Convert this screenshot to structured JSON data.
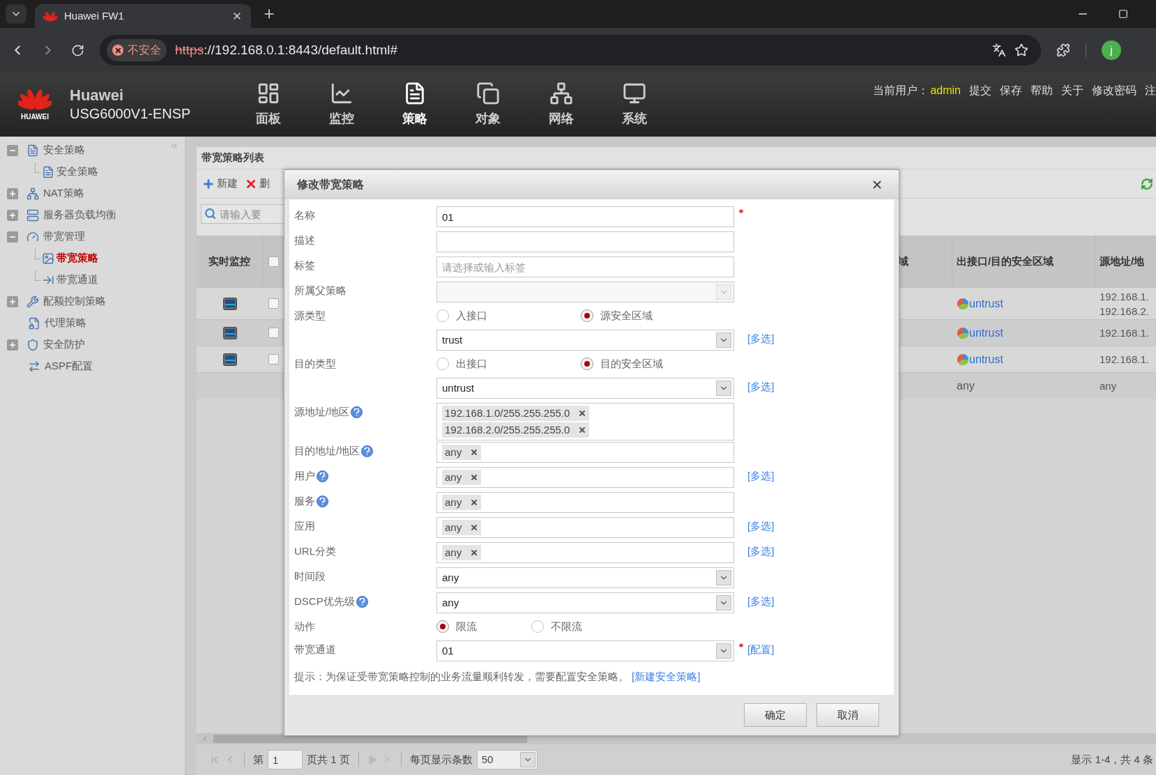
{
  "browser": {
    "tab_title": "Huawei FW1",
    "security_label": "不安全",
    "url_scheme": "https",
    "url_rest": "://192.168.0.1:8443/default.html#",
    "profile_initial": "j"
  },
  "header": {
    "logo_text": "HUAWEI",
    "brand": "Huawei",
    "model": "USG6000V1-ENSP",
    "nav": [
      {
        "label": "面板",
        "selected": false
      },
      {
        "label": "监控",
        "selected": false
      },
      {
        "label": "策略",
        "selected": true
      },
      {
        "label": "对象",
        "selected": false
      },
      {
        "label": "网络",
        "selected": false
      },
      {
        "label": "系统",
        "selected": false
      }
    ],
    "user_label": "当前用户：",
    "user": "admin",
    "actions": [
      "提交",
      "保存",
      "帮助",
      "关于",
      "修改密码",
      "注"
    ]
  },
  "sidebar": {
    "items": [
      {
        "label": "安全策略",
        "expanded": true,
        "selected": false,
        "children": [
          {
            "label": "安全策略",
            "selected": false
          }
        ]
      },
      {
        "label": "NAT策略",
        "expanded": false,
        "selected": false
      },
      {
        "label": "服务器负载均衡",
        "expanded": false,
        "selected": false
      },
      {
        "label": "带宽管理",
        "expanded": true,
        "selected": false,
        "children": [
          {
            "label": "带宽策略",
            "selected": true
          },
          {
            "label": "带宽通道",
            "selected": false
          }
        ]
      },
      {
        "label": "配额控制策略",
        "expanded": false,
        "selected": false
      },
      {
        "label": "代理策略",
        "selected": false
      },
      {
        "label": "安全防护",
        "expanded": false,
        "selected": false
      },
      {
        "label": "ASPF配置",
        "selected": false
      }
    ]
  },
  "list": {
    "title": "带宽策略列表",
    "toolbar": [
      {
        "kind": "add",
        "label": "新建"
      },
      {
        "kind": "delete",
        "label": "删"
      }
    ],
    "search_placeholder": "请输入要",
    "table": {
      "columns": [
        "实时监控",
        "域",
        "出接口/目的安全区域",
        "源地址/地"
      ],
      "select_all_checked": false,
      "rows": [
        {
          "kind": "policy",
          "checked": false,
          "out_zone": "untrust",
          "source": [
            "192.168.1.",
            "192.168.2."
          ]
        },
        {
          "kind": "policy",
          "checked": false,
          "out_zone": "untrust",
          "source": [
            "192.168.1."
          ]
        },
        {
          "kind": "policy",
          "checked": false,
          "out_zone": "untrust",
          "source": [
            "192.168.1."
          ]
        },
        {
          "kind": "default",
          "out_zone": "any",
          "source": [
            "any"
          ]
        }
      ]
    }
  },
  "pager": {
    "page_prefix": "第",
    "page": "1",
    "page_total": "页共 1 页",
    "page_size_label": "每页显示条数",
    "page_size": "50",
    "summary": "显示 1-4，共 4 条"
  },
  "dialog": {
    "title": "修改带宽策略",
    "fields": [
      {
        "kind": "text",
        "label": "名称",
        "value": "01",
        "required": true,
        "help": false
      },
      {
        "kind": "text",
        "label": "描述",
        "required": false,
        "help": false
      },
      {
        "kind": "text",
        "label": "标签",
        "placeholder": "请选择或输入标签",
        "required": false,
        "help": false
      },
      {
        "kind": "select",
        "label": "所属父策略",
        "disabled": true,
        "required": false,
        "help": false
      },
      {
        "kind": "radio",
        "label": "源类型",
        "required": false,
        "help": false,
        "options": [
          {
            "label": "入接口",
            "selected": false
          },
          {
            "label": "源安全区域",
            "selected": true
          }
        ]
      },
      {
        "kind": "select",
        "value": "trust",
        "disabled": false,
        "required": false,
        "help": false,
        "link": "[多选]"
      },
      {
        "kind": "radio",
        "label": "目的类型",
        "required": false,
        "help": false,
        "options": [
          {
            "label": "出接口",
            "selected": false
          },
          {
            "label": "目的安全区域",
            "selected": true
          }
        ]
      },
      {
        "kind": "select",
        "value": "untrust",
        "disabled": false,
        "required": false,
        "help": false,
        "link": "[多选]"
      },
      {
        "kind": "tags",
        "label": "源地址/地区",
        "required": false,
        "help": true,
        "tags": [
          "192.168.1.0/255.255.255.0",
          "192.168.2.0/255.255.255.0"
        ]
      },
      {
        "kind": "tags",
        "label": "目的地址/地区",
        "required": false,
        "help": true,
        "tags": [
          "any"
        ]
      },
      {
        "kind": "tags",
        "label": "用户",
        "required": false,
        "help": true,
        "tags": [
          "any"
        ],
        "link": "[多选]"
      },
      {
        "kind": "tags",
        "label": "服务",
        "required": false,
        "help": true,
        "tags": [
          "any"
        ]
      },
      {
        "kind": "tags",
        "label": "应用",
        "required": false,
        "help": false,
        "tags": [
          "any"
        ],
        "link": "[多选]"
      },
      {
        "kind": "tags",
        "label": "URL分类",
        "required": false,
        "help": false,
        "tags": [
          "any"
        ],
        "link": "[多选]"
      },
      {
        "kind": "select",
        "label": "时间段",
        "value": "any",
        "disabled": false,
        "required": false,
        "help": false
      },
      {
        "kind": "select",
        "label": "DSCP优先级",
        "value": "any",
        "disabled": false,
        "required": false,
        "help": true,
        "link": "[多选]"
      },
      {
        "kind": "radio",
        "label": "动作",
        "required": false,
        "help": false,
        "options": [
          {
            "label": "限流",
            "selected": true
          },
          {
            "label": "不限流",
            "selected": false
          }
        ]
      },
      {
        "kind": "select",
        "label": "带宽通道",
        "value": "01",
        "disabled": false,
        "required": true,
        "help": false,
        "link": "[配置]"
      }
    ],
    "hint": "提示：为保证受带宽策略控制的业务流量顺利转发，需要配置安全策略。",
    "hint_link": "[新建安全策略]",
    "buttons": [
      "确定",
      "取消"
    ]
  }
}
